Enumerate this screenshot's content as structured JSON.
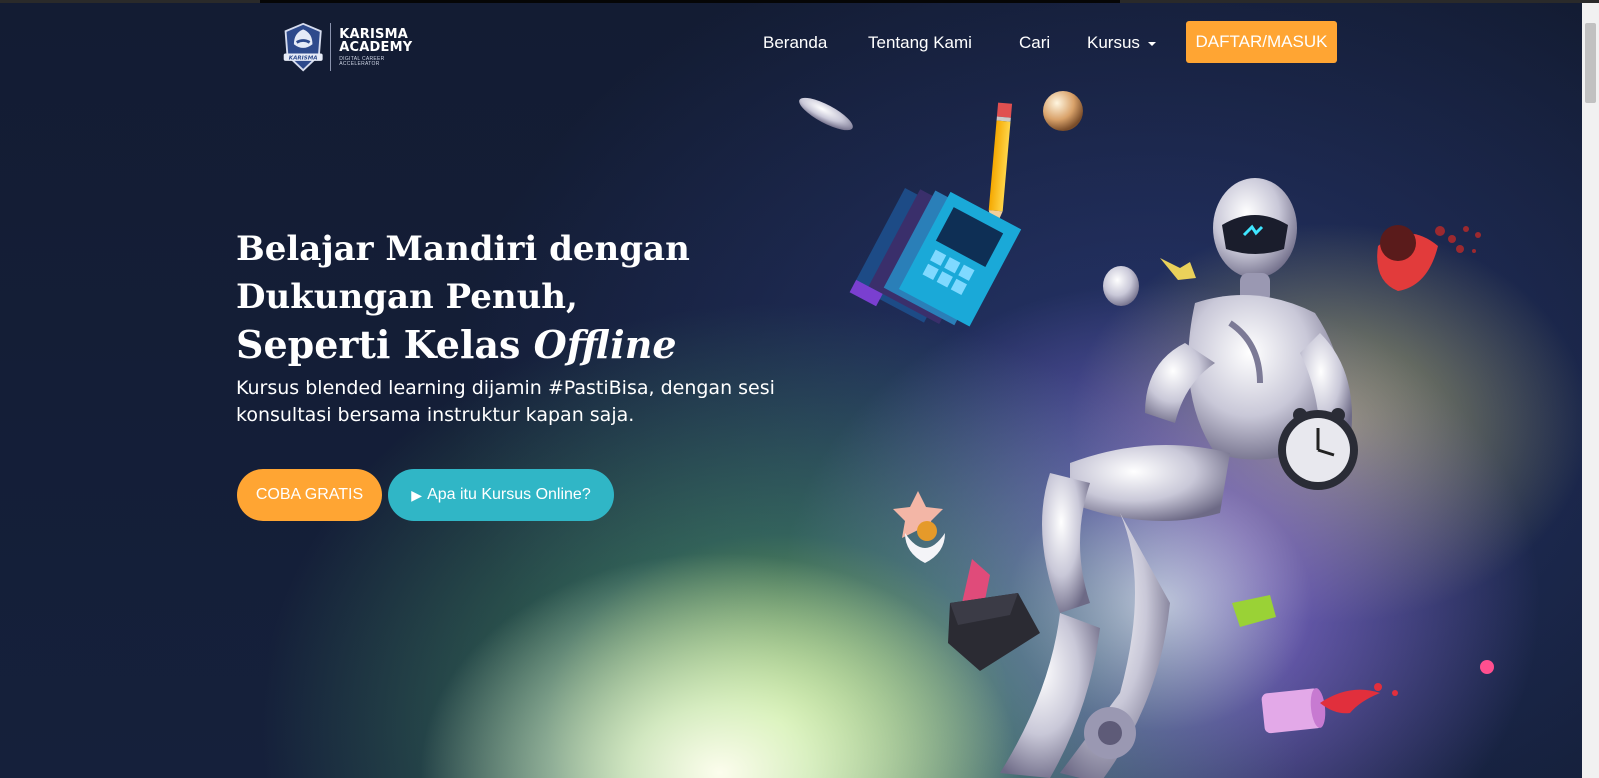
{
  "brand": {
    "line1": "KARISMA",
    "line2": "ACADEMY",
    "tagline": "DIGITAL CAREER ACCELERATOR",
    "emblem_text": "KARISMA"
  },
  "nav": {
    "items": [
      {
        "label": "Beranda"
      },
      {
        "label": "Tentang Kami"
      },
      {
        "label": "Cari"
      },
      {
        "label": "Kursus"
      }
    ],
    "cta_label": "DAFTAR/MASUK"
  },
  "hero": {
    "headline_line1": "Belajar Mandiri dengan",
    "headline_line2": "Dukungan Penuh,",
    "headline_line3_prefix": "Seperti Kelas ",
    "headline_line3_italic": "Offline",
    "subtext": "Kursus blended learning dijamin #PastiBisa, dengan sesi konsultasi bersama instruktur kapan saja.",
    "primary_button": "COBA GRATIS",
    "secondary_button": "Apa itu Kursus Online?",
    "secondary_icon": "▶"
  },
  "colors": {
    "background": "#141d34",
    "accent_orange": "#ffa533",
    "accent_teal": "#30b6c6"
  },
  "icons": [
    "karisma-shield-logo",
    "caret-down-icon",
    "play-icon"
  ]
}
